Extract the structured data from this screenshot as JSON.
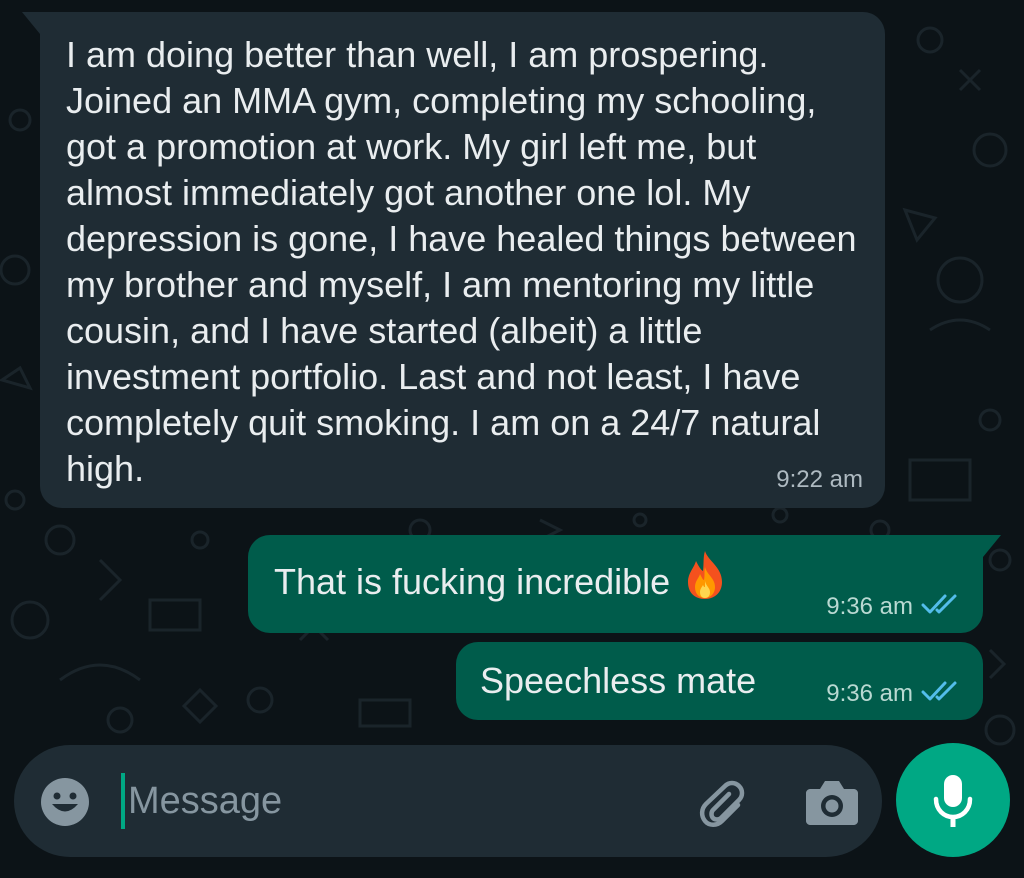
{
  "colors": {
    "background": "#0c1317",
    "incoming_bubble": "#1f2c34",
    "outgoing_bubble": "#005c4b",
    "accent": "#00a884",
    "read_ticks": "#53bdeb"
  },
  "messages": [
    {
      "direction": "incoming",
      "text": "I am doing better than well, I am prospering. Joined an MMA gym, completing my schooling, got a promotion at work. My girl left me, but almost immediately got another one lol. My depression is gone, I have healed things between my brother and myself, I am mentoring my little cousin, and I have started (albeit) a little investment portfolio. Last and not least, I have completely quit smoking. I am on a 24/7 natural high.",
      "time": "9:22 am"
    },
    {
      "direction": "outgoing",
      "text": "That is fucking incredible",
      "emoji": "fire-emoji",
      "time": "9:36 am",
      "status": "read"
    },
    {
      "direction": "outgoing",
      "text": "Speechless mate",
      "time": "9:36 am",
      "status": "read"
    }
  ],
  "composer": {
    "placeholder": "Message",
    "value": "",
    "emoji_icon": "smiley-icon",
    "attach_icon": "paperclip-icon",
    "camera_icon": "camera-icon",
    "mic_icon": "microphone-icon"
  }
}
